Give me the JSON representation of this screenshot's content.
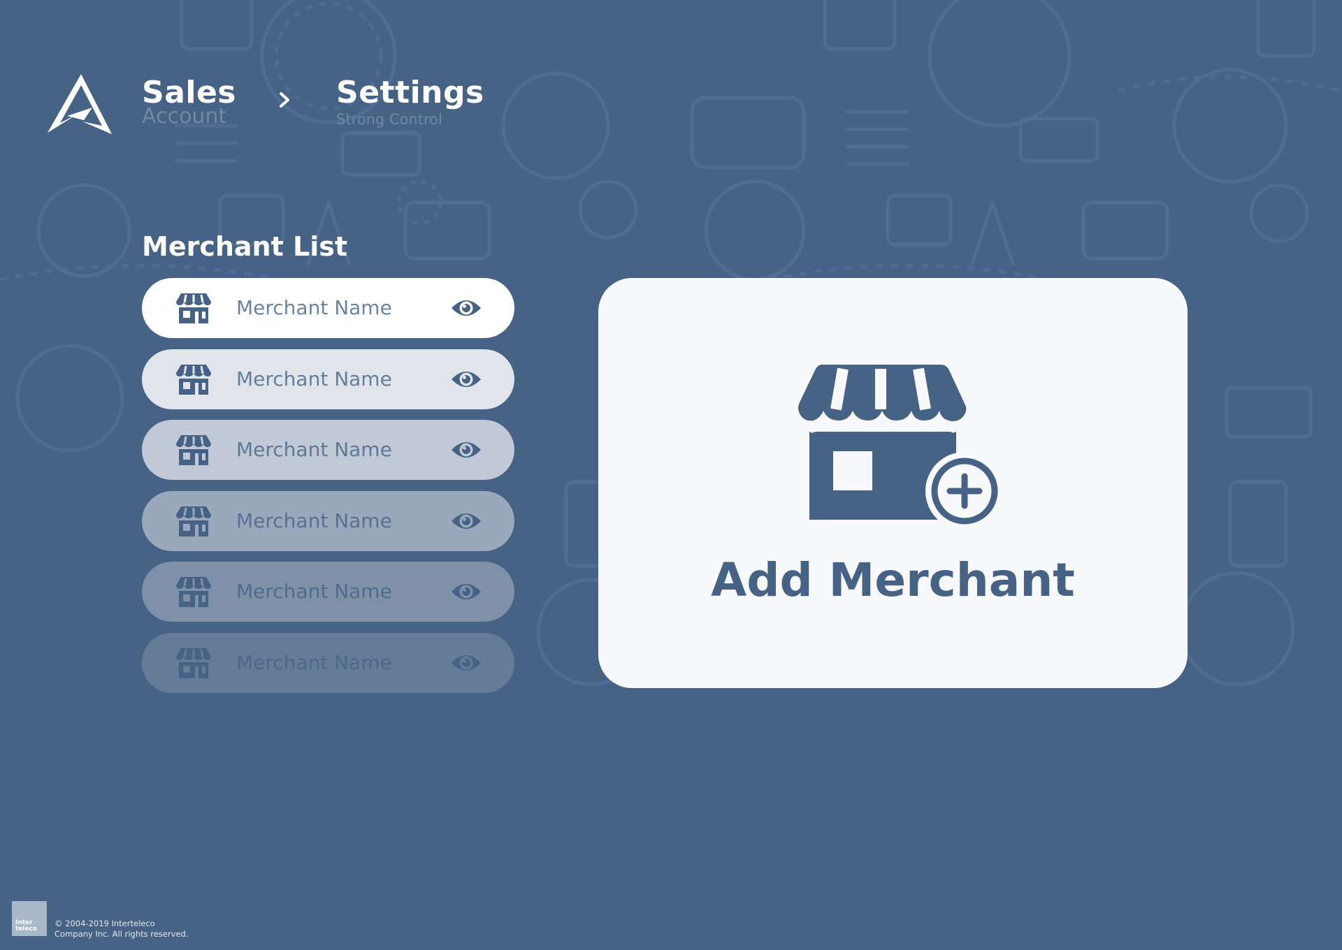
{
  "header": {
    "breadcrumb": [
      {
        "title": "Sales",
        "subtitle": "Account"
      },
      {
        "title": "Settings",
        "subtitle": "Strong Control"
      }
    ],
    "separator_icon": "chevron-right-icon",
    "logo_icon": "triangle-logo-icon"
  },
  "merchant_list": {
    "title": "Merchant List",
    "items": [
      {
        "name": "Merchant Name",
        "icon": "store-icon",
        "action_icon": "eye-icon"
      },
      {
        "name": "Merchant Name",
        "icon": "store-icon",
        "action_icon": "eye-icon"
      },
      {
        "name": "Merchant Name",
        "icon": "store-icon",
        "action_icon": "eye-icon"
      },
      {
        "name": "Merchant Name",
        "icon": "store-icon",
        "action_icon": "eye-icon"
      },
      {
        "name": "Merchant Name",
        "icon": "store-icon",
        "action_icon": "eye-icon"
      },
      {
        "name": "Merchant Name",
        "icon": "store-icon",
        "action_icon": "eye-icon"
      }
    ]
  },
  "add_merchant": {
    "label": "Add Merchant",
    "icon": "store-add-icon"
  },
  "footer": {
    "logo_text": "Inter teleco",
    "copyright_line1": "©  2004-2019 Interteleco",
    "copyright_line2": "Company Inc. All rights reserved."
  },
  "colors": {
    "background": "#466284",
    "card": "#f8f9fc",
    "accent": "#466284",
    "muted_text": "#6a84a3"
  }
}
